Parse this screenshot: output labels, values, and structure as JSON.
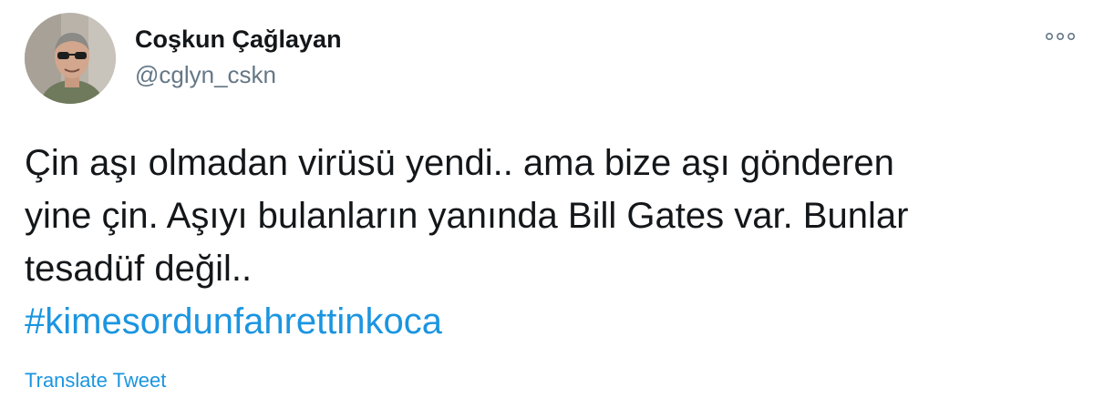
{
  "tweet": {
    "author": {
      "display_name": "Coşkun Çağlayan",
      "handle": "@cglyn_cskn"
    },
    "more_icon": "more-horizontal-icon",
    "text_lines": [
      "Çin aşı olmadan virüsü yendi.. ama bize aşı gönderen",
      "yine çin. Aşıyı bulanların yanında Bill Gates var. Bunlar",
      "tesadüf değil.."
    ],
    "hashtag": "#kimesordunfahrettinkoca",
    "translate_label": "Translate Tweet"
  },
  "colors": {
    "text": "#14171a",
    "secondary": "#657786",
    "link": "#1b95e0",
    "background": "#ffffff"
  }
}
